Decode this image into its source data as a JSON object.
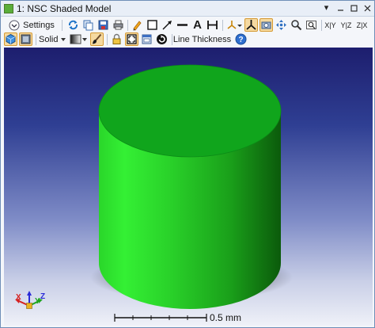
{
  "window": {
    "title": "1: NSC Shaded Model"
  },
  "toolbar": {
    "settings_label": "Settings",
    "render_mode": "Solid",
    "line_thickness_label": "Line Thickness",
    "rotate_x_label": "X|Y",
    "rotate_y_label": "Y|Z",
    "rotate_z_label": "Z|X",
    "text_tool_label": "A"
  },
  "viewport": {
    "scale_bar_label": "0.5 mm",
    "axes": {
      "x": "X",
      "y": "Y",
      "z": "Z"
    }
  },
  "colors": {
    "cylinder_light": "#33ef33",
    "cylinder_mid": "#1fb81f",
    "cylinder_dark": "#0c5a0c",
    "cylinder_top": "#0fa51a",
    "accent_pressed": "#f5d9a0"
  },
  "icons": {
    "refresh": "refresh-icon",
    "copy": "copy-icon",
    "save": "save-icon",
    "print": "print-icon",
    "pencil": "pencil-icon",
    "rectangle": "rectangle-icon",
    "arrow": "arrow-icon",
    "line": "line-icon",
    "dimension": "dimension-icon",
    "move": "move-icon",
    "zoom": "magnifier-icon",
    "help": "help-icon"
  }
}
